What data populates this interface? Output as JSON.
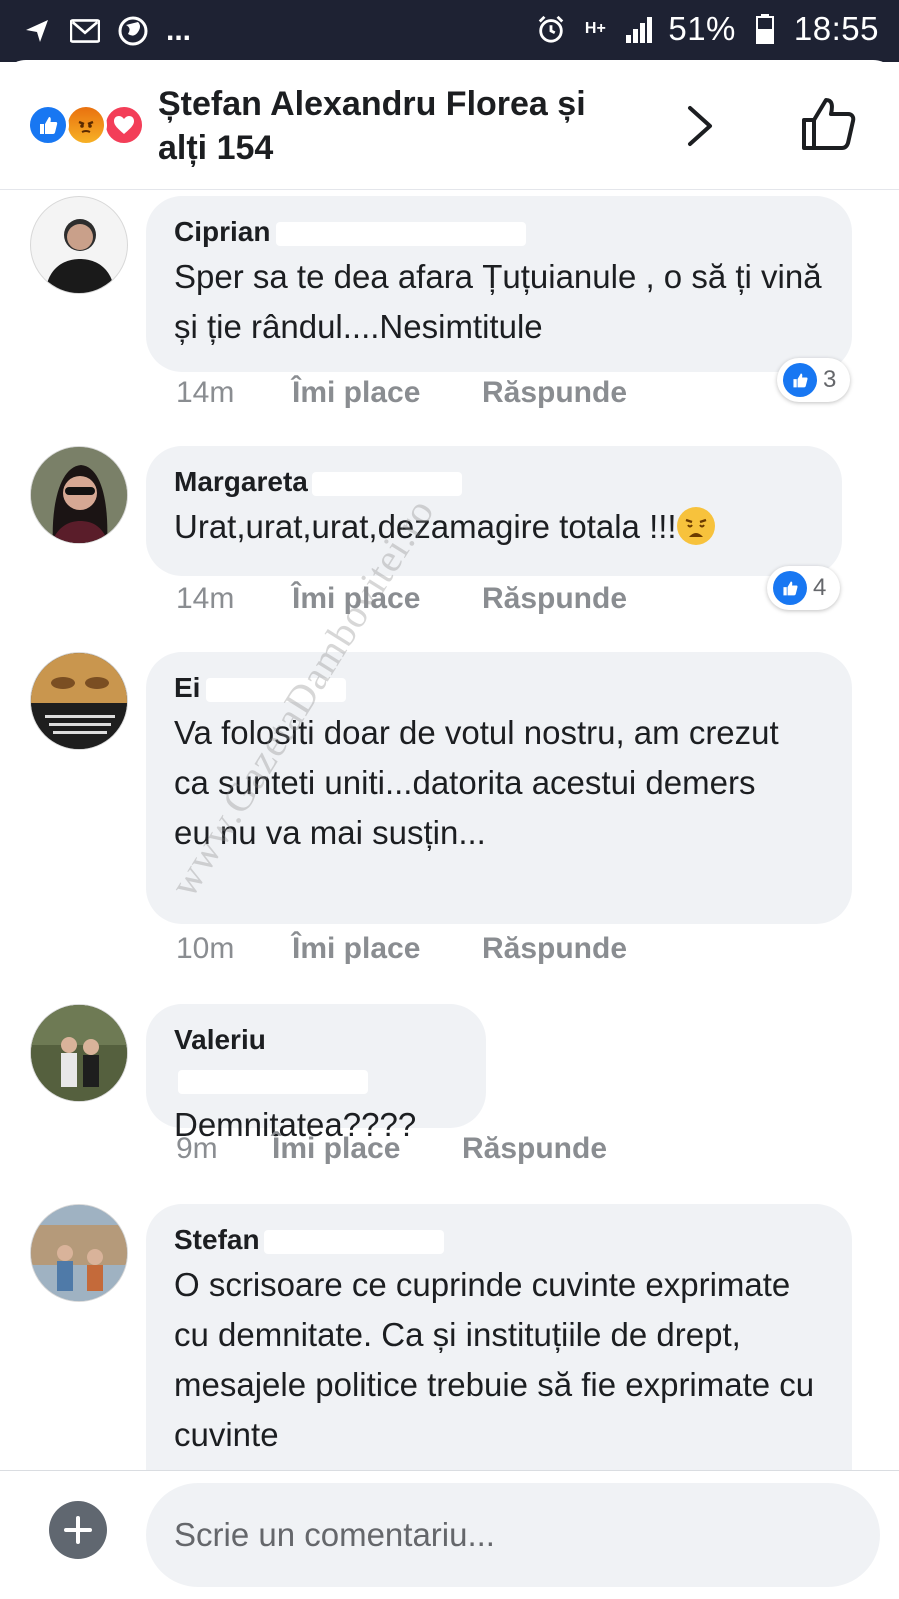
{
  "status_bar": {
    "battery": "51%",
    "time": "18:55",
    "dots": "...",
    "network": "H+"
  },
  "header": {
    "title": "Ștefan Alexandru Florea și alți 154",
    "reactions": [
      "like",
      "angry",
      "love"
    ]
  },
  "comments": [
    {
      "author": "Ciprian",
      "text": "Sper sa te dea afara Țuțuianule , o să ți vină și ție rândul....Nesimtitule",
      "time": "14m",
      "like_label": "Îmi place",
      "reply_label": "Răspunde",
      "likes": "3"
    },
    {
      "author": "Margareta",
      "text": "Urat,urat,urat,dezamagire totala !!!",
      "time": "14m",
      "like_label": "Îmi place",
      "reply_label": "Răspunde",
      "likes": "4"
    },
    {
      "author": "Ei",
      "text": "Va folositi doar de votul nostru, am crezut ca sunteti uniti...datorita acestui  demers eu nu va mai susțin...",
      "time": "10m",
      "like_label": "Îmi place",
      "reply_label": "Răspunde"
    },
    {
      "author": "Valeriu",
      "text": "Demnitatea????",
      "time": "9m",
      "like_label": "Îmi place",
      "reply_label": "Răspunde"
    },
    {
      "author": "Stefan",
      "text": "O scrisoare ce cuprinde cuvinte exprimate cu demnitate. Ca și instituțiile de drept, mesajele politice trebuie să fie exprimate cu cuvinte"
    }
  ],
  "watermark": "www.GazetaDambovitei.ro",
  "composer": {
    "placeholder": "Scrie un comentariu..."
  },
  "colors": {
    "status_bar_bg": "#1e2233",
    "like_blue": "#1877f2",
    "bubble_bg": "#f0f2f5",
    "meta_gray": "#8a8d91"
  }
}
